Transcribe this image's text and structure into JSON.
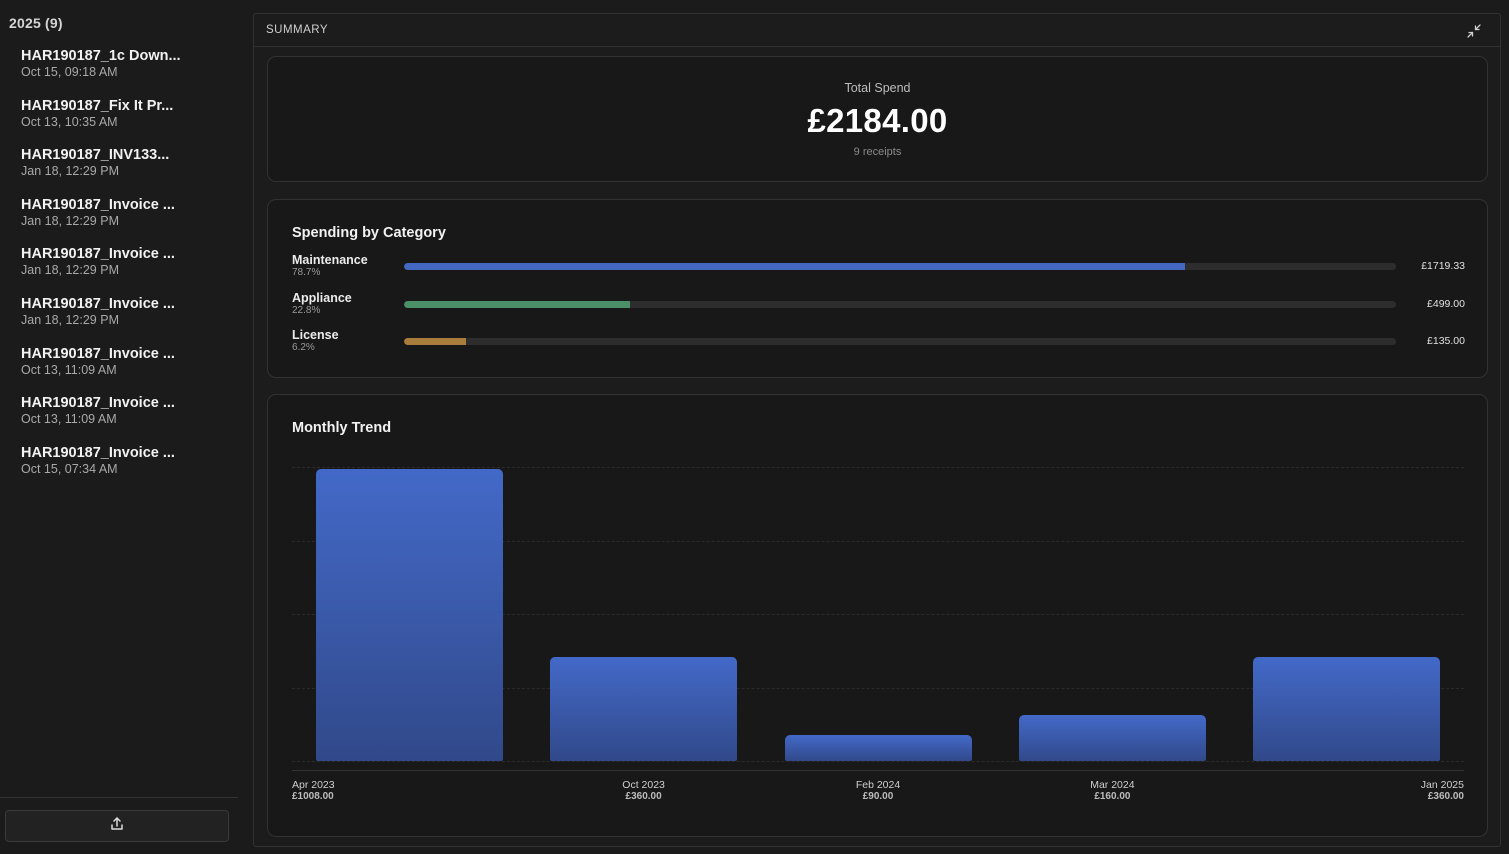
{
  "sidebar": {
    "group_header": "2025 (9)",
    "files": [
      {
        "name": "HAR190187_1c Down...",
        "date": "Oct 15, 09:18 AM"
      },
      {
        "name": "HAR190187_Fix It Pr...",
        "date": "Oct 13, 10:35 AM"
      },
      {
        "name": "HAR190187_INV133...",
        "date": "Jan 18, 12:29 PM"
      },
      {
        "name": "HAR190187_Invoice ...",
        "date": "Jan 18, 12:29 PM"
      },
      {
        "name": "HAR190187_Invoice ...",
        "date": "Jan 18, 12:29 PM"
      },
      {
        "name": "HAR190187_Invoice ...",
        "date": "Jan 18, 12:29 PM"
      },
      {
        "name": "HAR190187_Invoice ...",
        "date": "Oct 13, 11:09 AM"
      },
      {
        "name": "HAR190187_Invoice ...",
        "date": "Oct 13, 11:09 AM"
      },
      {
        "name": "HAR190187_Invoice ...",
        "date": "Oct 15, 07:34 AM"
      }
    ],
    "upload_icon": "upload-icon"
  },
  "panel": {
    "title": "SUMMARY",
    "collapse_icon": "collapse-icon"
  },
  "total": {
    "label": "Total Spend",
    "amount": "£2184.00",
    "count": "9 receipts"
  },
  "categories": {
    "title": "Spending by Category",
    "items": [
      {
        "name": "Maintenance",
        "pct": "78.7%",
        "value": "£1719.33",
        "fraction": 0.787,
        "color": "#4467c2"
      },
      {
        "name": "Appliance",
        "pct": "22.8%",
        "value": "£499.00",
        "fraction": 0.228,
        "color": "#4a8f68"
      },
      {
        "name": "License",
        "pct": "6.2%",
        "value": "£135.00",
        "fraction": 0.062,
        "color": "#a97d3c"
      }
    ]
  },
  "trend": {
    "title": "Monthly Trend"
  },
  "chart_data": {
    "type": "bar",
    "categories": [
      "Apr 2023",
      "Oct 2023",
      "Feb 2024",
      "Mar 2024",
      "Jan 2025"
    ],
    "values": [
      1008,
      360,
      90,
      160,
      360
    ],
    "value_labels": [
      "£1008.00",
      "£360.00",
      "£90.00",
      "£160.00",
      "£360.00"
    ],
    "ylim": [
      0,
      1008
    ],
    "grid": true,
    "bar_color": "#4369c8"
  }
}
